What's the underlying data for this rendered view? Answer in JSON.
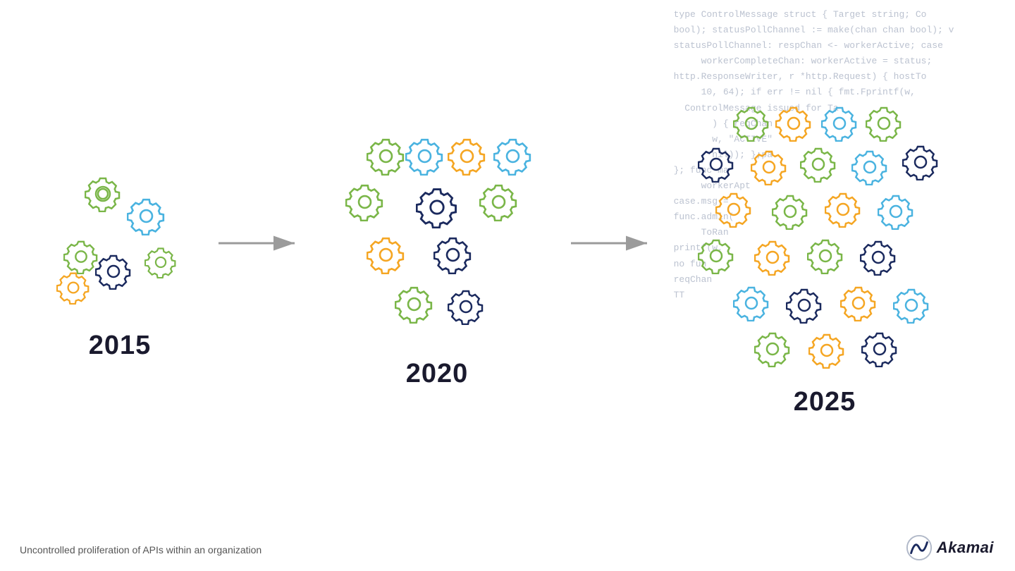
{
  "page": {
    "background": "#ffffff"
  },
  "code_lines": [
    "type ControlMessage struct { Target string; Co",
    "bool); statusPollChannel := make(chan chan bool); v",
    "statusPollChannel: respChan <- workerActive; case",
    "workerCompleteChan: workerActive = status;",
    "http.ResponseWriter, r *http.Request) { hostTo",
    "10, 64); if err != nil { fmt.Fprintf(w,",
    "ControlMessage issued for Ta",
    ") { reqChan",
    "w, \"ACTIVE\"",
    "nil)); };pa",
    "}: func ma",
    "workerApt",
    "case.msg =",
    "func.admin(",
    "ToRan",
    "printf(w,",
    "no fun",
    "reqChan",
    "TT"
  ],
  "years": [
    "2015",
    "2020",
    "2025"
  ],
  "bottom_text": "Uncontrolled proliferation of APIs within an organization",
  "akamai_text": "Akamai",
  "colors": {
    "green": "#7ab648",
    "orange": "#f5a623",
    "blue": "#4ab3e0",
    "dark_navy": "#1b2a5e",
    "arrow_gray": "#9b9b9b"
  },
  "gear_sizes": {
    "small": 38,
    "medium": 48,
    "large": 55
  }
}
